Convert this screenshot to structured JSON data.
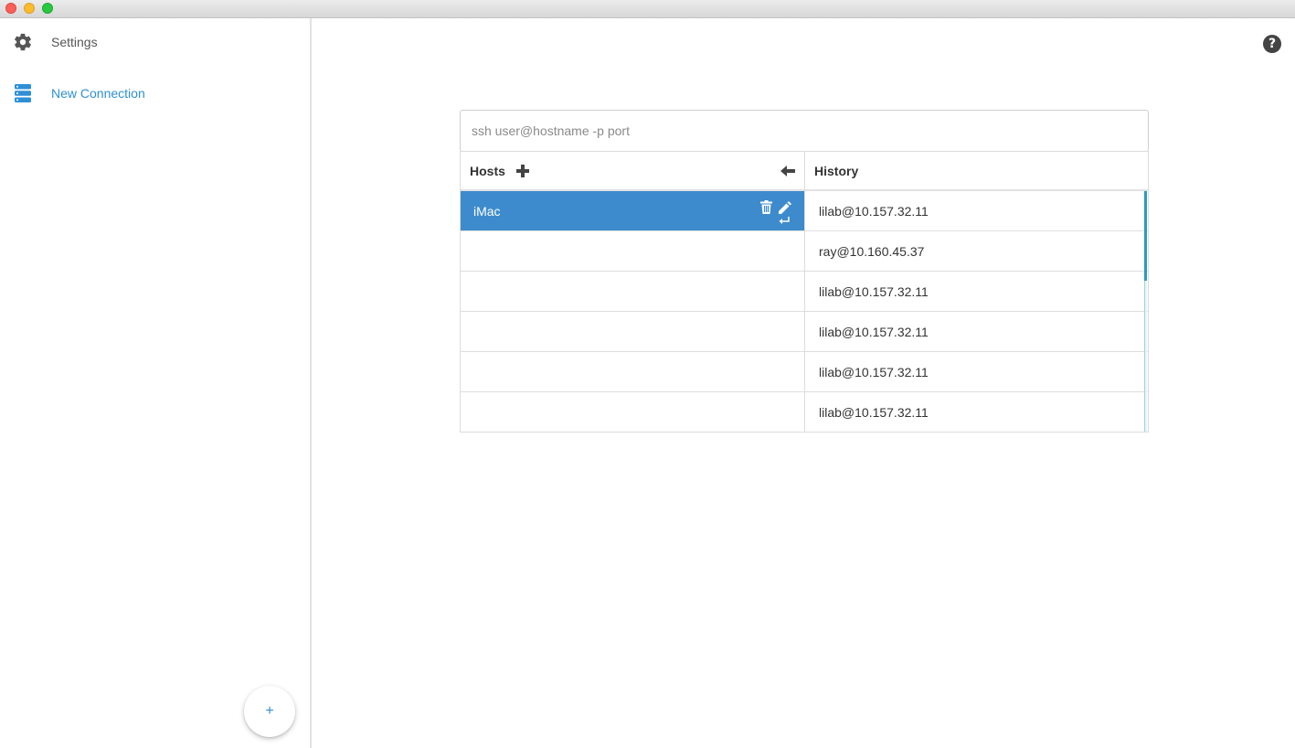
{
  "sidebar": {
    "settings_label": "Settings",
    "new_connection_label": "New Connection",
    "fab_label": "+"
  },
  "help_label": "?",
  "ssh": {
    "placeholder": "ssh user@hostname -p port",
    "value": ""
  },
  "hosts": {
    "title": "Hosts",
    "items": [
      {
        "name": "iMac",
        "selected": true
      },
      {
        "name": ""
      },
      {
        "name": ""
      },
      {
        "name": ""
      },
      {
        "name": ""
      },
      {
        "name": ""
      }
    ]
  },
  "history": {
    "title": "History",
    "items": [
      "lilab@10.157.32.11",
      "ray@10.160.45.37",
      "lilab@10.157.32.11",
      "lilab@10.157.32.11",
      "lilab@10.157.32.11",
      "lilab@10.157.32.11"
    ]
  },
  "icons": {
    "settings": "gear-icon",
    "new_connection": "server-stack-icon",
    "help": "question-circle-icon",
    "add_host": "plus-icon",
    "collapse": "arrow-left-icon",
    "delete": "trash-icon",
    "edit": "pencil-icon",
    "connect": "enter-return-icon"
  },
  "colors": {
    "accent": "#2e8fd6",
    "selected_row": "#3d8bcd",
    "scrollbar": "#2a9bbd"
  }
}
